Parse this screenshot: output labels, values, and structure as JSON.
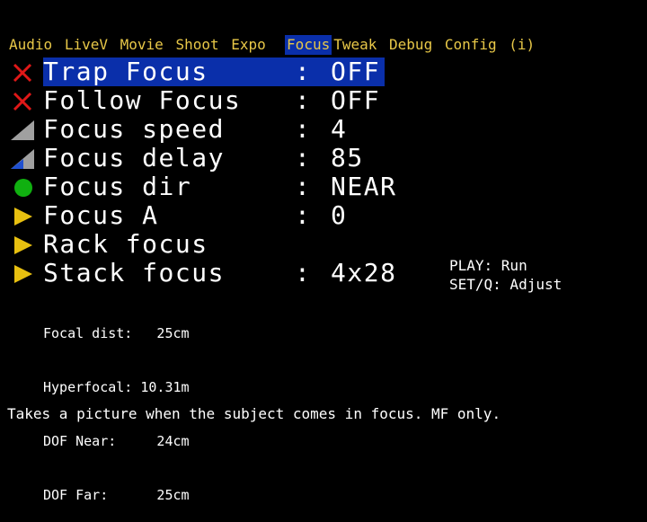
{
  "tabs": [
    {
      "label": "Audio"
    },
    {
      "label": "LiveV"
    },
    {
      "label": "Movie"
    },
    {
      "label": "Shoot"
    },
    {
      "label": "Expo"
    },
    {
      "label": "Focus"
    },
    {
      "label": "Tweak"
    },
    {
      "label": "Debug"
    },
    {
      "label": "Config"
    },
    {
      "label": "(i)"
    }
  ],
  "active_tab": "Focus",
  "menu": {
    "items": [
      {
        "label": "Trap Focus",
        "sep": ":",
        "value": "OFF",
        "icon": "x-icon"
      },
      {
        "label": "Follow Focus",
        "sep": ":",
        "value": "OFF",
        "icon": "x-icon"
      },
      {
        "label": "Focus speed",
        "sep": ":",
        "value": "4",
        "icon": "gray-ramp-icon"
      },
      {
        "label": "Focus delay",
        "sep": ":",
        "value": "85",
        "icon": "blue-ramp-icon"
      },
      {
        "label": "Focus dir",
        "sep": ":",
        "value": "NEAR",
        "icon": "green-dot-icon"
      },
      {
        "label": "Focus A",
        "sep": ":",
        "value": "0",
        "icon": "arrow-icon"
      },
      {
        "label": "Rack focus",
        "sep": "",
        "value": "",
        "icon": "arrow-icon"
      },
      {
        "label": "Stack focus",
        "sep": ":",
        "value": "4x28",
        "icon": "arrow-icon"
      }
    ]
  },
  "hints": {
    "play": "PLAY: Run",
    "set": "SET/Q: Adjust"
  },
  "info": {
    "focal_dist": "Focal dist:   25cm",
    "hyperfocal": "Hyperfocal: 10.31m",
    "dof_near": "DOF Near:     24cm",
    "dof_far": "DOF Far:      25cm"
  },
  "help_text": "Takes a picture when the subject comes in focus. MF only.",
  "colors": {
    "background": "#000000",
    "tab_text": "#e8c848",
    "highlight": "#0a2faa",
    "x_icon": "#e01818",
    "arrow_icon": "#e8c010",
    "dot_icon": "#10b010",
    "ramp_gray": "#a0a0a0",
    "ramp_blue": "#2050d0"
  }
}
